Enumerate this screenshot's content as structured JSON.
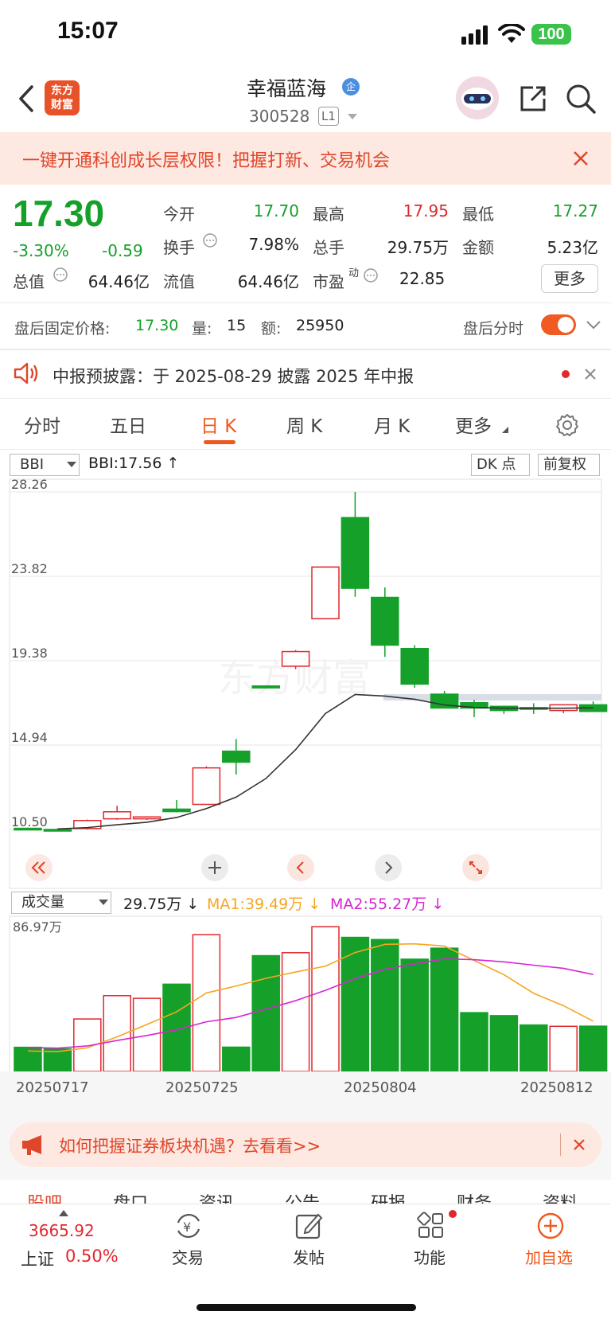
{
  "status": {
    "time": "15:07",
    "battery": "100"
  },
  "header": {
    "logo_line1": "东方",
    "logo_line2": "财富",
    "name": "幸福蓝海",
    "code": "300528",
    "level": "L1"
  },
  "promo": {
    "text": "一键开通科创成长层权限！把握打新、交易机会"
  },
  "quote": {
    "price": "17.30",
    "change_pct": "-3.30%",
    "change": "-0.59",
    "open_label": "今开",
    "open": "17.70",
    "high_label": "最高",
    "high": "17.95",
    "low_label": "最低",
    "low": "17.27",
    "turnover_label": "换手",
    "turnover": "7.98%",
    "volume_label": "总手",
    "volume": "29.75万",
    "amount_label": "金额",
    "amount": "5.23亿",
    "mcap_label": "总值",
    "mcap": "64.46亿",
    "float_label": "流值",
    "float": "64.46亿",
    "pe_label": "市盈",
    "pe_sup": "动",
    "pe": "22.85",
    "more": "更多"
  },
  "after_hours": {
    "label": "盘后固定价格:",
    "price": "17.30",
    "qty_label": "量:",
    "qty": "15",
    "amt_label": "额:",
    "amt": "25950",
    "toggle_label": "盘后分时"
  },
  "notice": {
    "text": "中报预披露：于 2025-08-29 披露 2025 年中报"
  },
  "tabs": [
    "分时",
    "五日",
    "日 K",
    "周 K",
    "月 K",
    "更多"
  ],
  "chart_toolbar": {
    "indicator": "BBI",
    "bbi_value": "BBI:17.56 ↑",
    "dk": "DK 点",
    "adjust": "前复权"
  },
  "watermark": "东方财富",
  "volume_toolbar": {
    "indicator": "成交量",
    "vol": "29.75万 ↓",
    "ma1": "MA1:39.49万 ↓",
    "ma2": "MA2:55.27万 ↓",
    "max_label": "86.97万"
  },
  "chart_data": {
    "type": "candlestick",
    "dates": [
      "20250716",
      "20250717",
      "20250718",
      "20250721",
      "20250722",
      "20250723",
      "20250724",
      "20250725",
      "20250728",
      "20250729",
      "20250730",
      "20250731",
      "20250801",
      "20250804",
      "20250805",
      "20250806",
      "20250807",
      "20250808",
      "20250811",
      "20250812"
    ],
    "x_tick_labels": [
      "20250717",
      "20250725",
      "20250804",
      "20250812"
    ],
    "y_tick_labels": [
      "28.26",
      "23.82",
      "19.38",
      "14.94",
      "10.50"
    ],
    "ylim": [
      10.5,
      28.26
    ],
    "candles": [
      {
        "o": 10.56,
        "c": 10.52,
        "h": 10.6,
        "l": 10.48
      },
      {
        "o": 10.5,
        "c": 10.45,
        "h": 10.55,
        "l": 10.4
      },
      {
        "o": 10.55,
        "c": 10.97,
        "h": 11.02,
        "l": 10.5
      },
      {
        "o": 11.06,
        "c": 11.43,
        "h": 11.75,
        "l": 11.01
      },
      {
        "o": 11.06,
        "c": 11.16,
        "h": 11.16,
        "l": 11.0
      },
      {
        "o": 11.57,
        "c": 11.44,
        "h": 12.05,
        "l": 11.4
      },
      {
        "o": 11.82,
        "c": 13.74,
        "h": 13.82,
        "l": 11.8
      },
      {
        "o": 14.62,
        "c": 14.04,
        "h": 15.26,
        "l": 13.39
      },
      {
        "o": 18.05,
        "c": 17.95,
        "h": 18.05,
        "l": 17.95
      },
      {
        "o": 19.09,
        "c": 19.86,
        "h": 19.94,
        "l": 18.94
      },
      {
        "o": 21.59,
        "c": 24.31,
        "h": 24.31,
        "l": 21.59
      },
      {
        "o": 26.91,
        "c": 23.19,
        "h": 28.26,
        "l": 22.74
      },
      {
        "o": 22.71,
        "c": 20.2,
        "h": 23.24,
        "l": 19.58
      },
      {
        "o": 20.02,
        "c": 18.15,
        "h": 20.2,
        "l": 17.95
      },
      {
        "o": 17.62,
        "c": 16.89,
        "h": 17.79,
        "l": 16.89
      },
      {
        "o": 17.17,
        "c": 16.89,
        "h": 17.32,
        "l": 16.41
      },
      {
        "o": 16.98,
        "c": 16.76,
        "h": 17.0,
        "l": 16.58
      },
      {
        "o": 16.91,
        "c": 16.86,
        "h": 17.14,
        "l": 16.58
      },
      {
        "o": 16.76,
        "c": 17.06,
        "h": 17.06,
        "l": 16.62
      },
      {
        "o": 17.06,
        "c": 16.71,
        "h": 17.24,
        "l": 16.71
      }
    ],
    "bbi": [
      null,
      10.53,
      10.6,
      10.75,
      10.88,
      11.13,
      11.6,
      12.2,
      13.18,
      14.7,
      16.6,
      17.6,
      17.52,
      17.35,
      17.05,
      16.92,
      16.88,
      16.88,
      16.88,
      16.9
    ],
    "volume": {
      "max": 86.97,
      "values": [
        14.5,
        13.5,
        31.5,
        45.5,
        43.9,
        52.4,
        82.1,
        14.6,
        69.5,
        71.3,
        86.9,
        80.5,
        79.2,
        67.4,
        74.0,
        35.3,
        33.5,
        27.9,
        27.1,
        27.2
      ],
      "ma1": [
        12.3,
        11.9,
        14.2,
        20.8,
        28.2,
        35.8,
        47.1,
        51.3,
        55.9,
        59.7,
        63.2,
        71.4,
        76.3,
        76.6,
        75.3,
        66.6,
        58.1,
        46.9,
        39.5,
        30.2
      ],
      "ma2": [
        14.4,
        14.0,
        15.3,
        18.6,
        21.6,
        25.0,
        29.8,
        32.4,
        37.4,
        42.5,
        48.7,
        55.7,
        61.3,
        64.6,
        67.6,
        67.1,
        65.8,
        63.8,
        61.9,
        58.2
      ]
    }
  },
  "bottom_banner": {
    "text": "如何把握证券板块机遇？去看看>>"
  },
  "sub_tabs": [
    "股吧",
    "盘口",
    "资讯",
    "公告",
    "研报",
    "财务",
    "资料"
  ],
  "bottom_nav": {
    "index_value": "3665.92",
    "index_name": "上证",
    "index_change": "0.50%",
    "trade": "交易",
    "post": "发帖",
    "features": "功能",
    "add": "加自选"
  }
}
